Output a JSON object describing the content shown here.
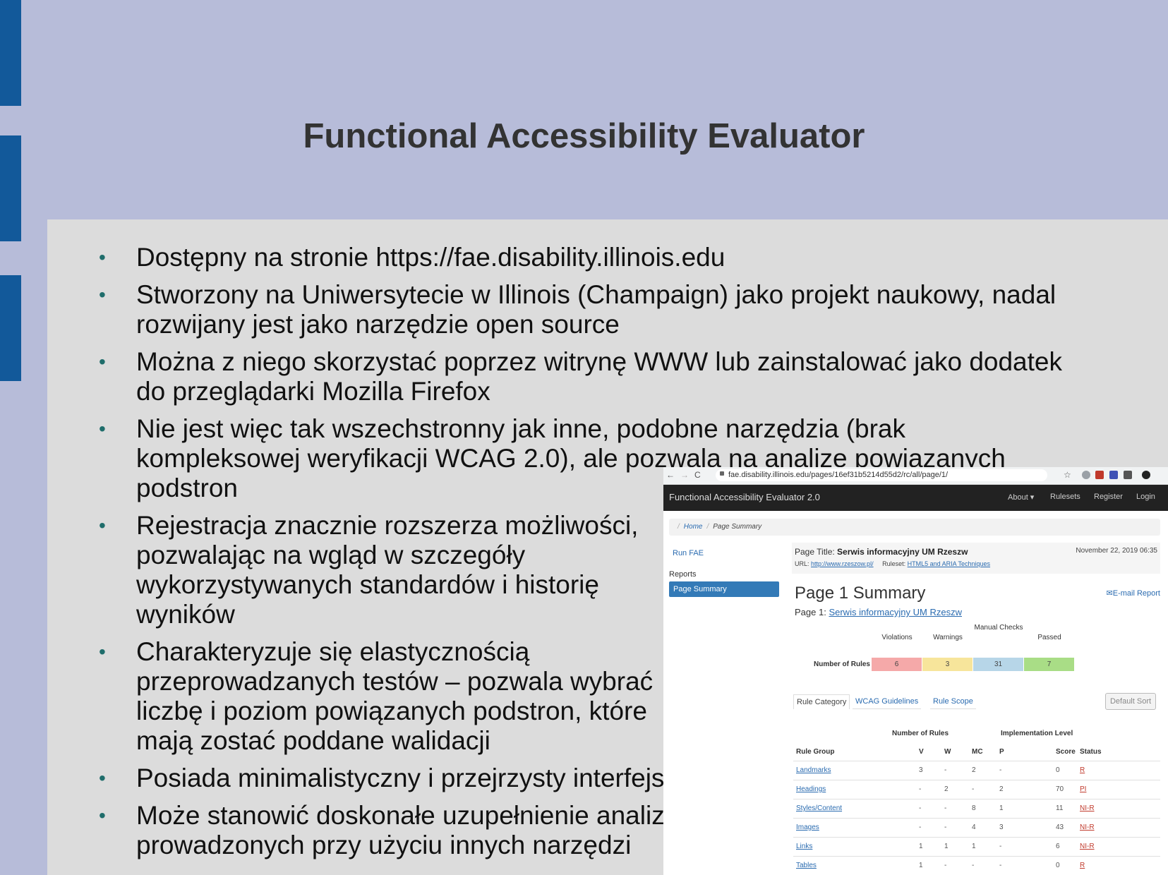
{
  "slide": {
    "title": "Functional Accessibility Evaluator",
    "bullet_symbol": "•",
    "bullets": [
      [
        "Dostępny na stronie https://fae.disability.illinois.edu"
      ],
      [
        "Stworzony na Uniwersytecie w Illinois (Champaign) jako projekt naukowy, nadal",
        "rozwijany jest jako narzędzie open source"
      ],
      [
        "Można z niego skorzystać poprzez witrynę WWW lub zainstalować jako dodatek",
        "do przeglądarki Mozilla Firefox"
      ],
      [
        "Nie jest więc tak wszechstronny jak inne, podobne narzędzia (brak",
        "kompleksowej weryfikacji WCAG 2.0), ale pozwala na analizę powiązanych",
        "podstron"
      ],
      [
        "Rejestracja znacznie rozszerza możliwości,",
        "pozwalając na wgląd w szczegóły",
        "wykorzystywanych standardów i historię",
        "wyników"
      ],
      [
        "Charakteryzuje się elastycznością",
        "przeprowadzanych testów – pozwala wybrać",
        "liczbę i poziom powiązanych podstron, które",
        "mają zostać poddane walidacji"
      ],
      [
        "Posiada minimalistyczny i przejrzysty interfejs"
      ],
      [
        "Może stanowić doskonałe uzupełnienie analiz",
        "prowadzonych przy użyciu innych narzędzi"
      ]
    ]
  },
  "screenshot": {
    "browser": {
      "back": "←",
      "forward": "→",
      "reload": "C",
      "url": "fae.disability.illinois.edu/pages/16ef31b5214d55d2/rc/all/page/1/",
      "star": "☆"
    },
    "navbar": {
      "brand": "Functional Accessibility Evaluator 2.0",
      "about": "About ▾",
      "rulesets": "Rulesets",
      "register": "Register",
      "login": "Login"
    },
    "breadcrumb": {
      "home": "Home",
      "current": "Page Summary",
      "sep": "/"
    },
    "sidebar": {
      "run": "Run FAE",
      "reports": "Reports",
      "page_summary": "Page Summary"
    },
    "info": {
      "page_title_label": "Page Title:",
      "page_title": "Serwis informacyjny UM Rzeszw",
      "date": "November 22, 2019 06:35",
      "url_label": "URL:",
      "url": "http://www.rzeszow.pl/",
      "ruleset_label": "Ruleset:",
      "ruleset": "HTML5 and ARIA Techniques"
    },
    "heading": "Page 1 Summary",
    "email": "✉E-mail Report",
    "page_label": "Page 1:",
    "page_link": "Serwis informacyjny UM Rzeszw",
    "summary": {
      "row_label": "Number of Rules",
      "headers": [
        "Violations",
        "Warnings",
        "Manual Checks",
        "Passed"
      ],
      "values": [
        "6",
        "3",
        "31",
        "7"
      ],
      "colors": [
        "#f5a9a9",
        "#f7e59b",
        "#b7d6e8",
        "#a9dd86"
      ]
    },
    "tabs": [
      "Rule Category",
      "WCAG Guidelines",
      "Rule Scope"
    ],
    "sort_button": "Default Sort",
    "table": {
      "group_number": "Number of Rules",
      "group_impl": "Implementation Level",
      "headers": [
        "Rule Group",
        "V",
        "W",
        "MC",
        "P",
        "Score",
        "Status"
      ],
      "rows": [
        [
          "Landmarks",
          "3",
          "-",
          "2",
          "-",
          "0",
          "R"
        ],
        [
          "Headings",
          "-",
          "2",
          "-",
          "2",
          "70",
          "PI"
        ],
        [
          "Styles/Content",
          "-",
          "-",
          "8",
          "1",
          "11",
          "NI-R"
        ],
        [
          "Images",
          "-",
          "-",
          "4",
          "3",
          "43",
          "NI-R"
        ],
        [
          "Links",
          "1",
          "1",
          "1",
          "-",
          "6",
          "NI-R"
        ],
        [
          "Tables",
          "1",
          "-",
          "-",
          "-",
          "0",
          "R"
        ]
      ]
    }
  }
}
